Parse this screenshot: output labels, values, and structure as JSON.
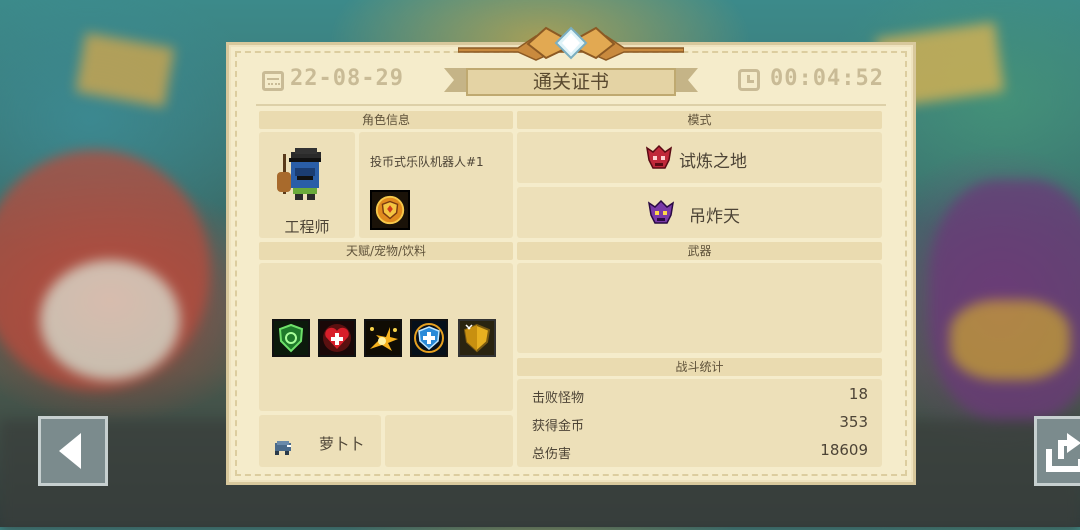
{
  "header": {
    "date": "22-08-29",
    "title": "通关证书",
    "time": "00:04:52"
  },
  "character": {
    "section_label": "角色信息",
    "class_name": "工程师",
    "skin_name": "投币式乐队机器人#1"
  },
  "mode": {
    "section_label": "模式",
    "primary": "试炼之地",
    "secondary": "吊炸天"
  },
  "talents": {
    "section_label": "天赋/宠物/饮料",
    "icons": [
      "green-shield-icon",
      "red-heart-cross-icon",
      "explosion-icon",
      "blue-shield-icon",
      "gold-shield-icon"
    ]
  },
  "pet": {
    "name": "萝卜卜"
  },
  "weapons": {
    "section_label": "武器"
  },
  "battle_stats": {
    "section_label": "战斗统计",
    "rows": [
      {
        "label": "击败怪物",
        "value": "18"
      },
      {
        "label": "获得金币",
        "value": "353"
      },
      {
        "label": "总伤害",
        "value": "18609"
      }
    ]
  }
}
